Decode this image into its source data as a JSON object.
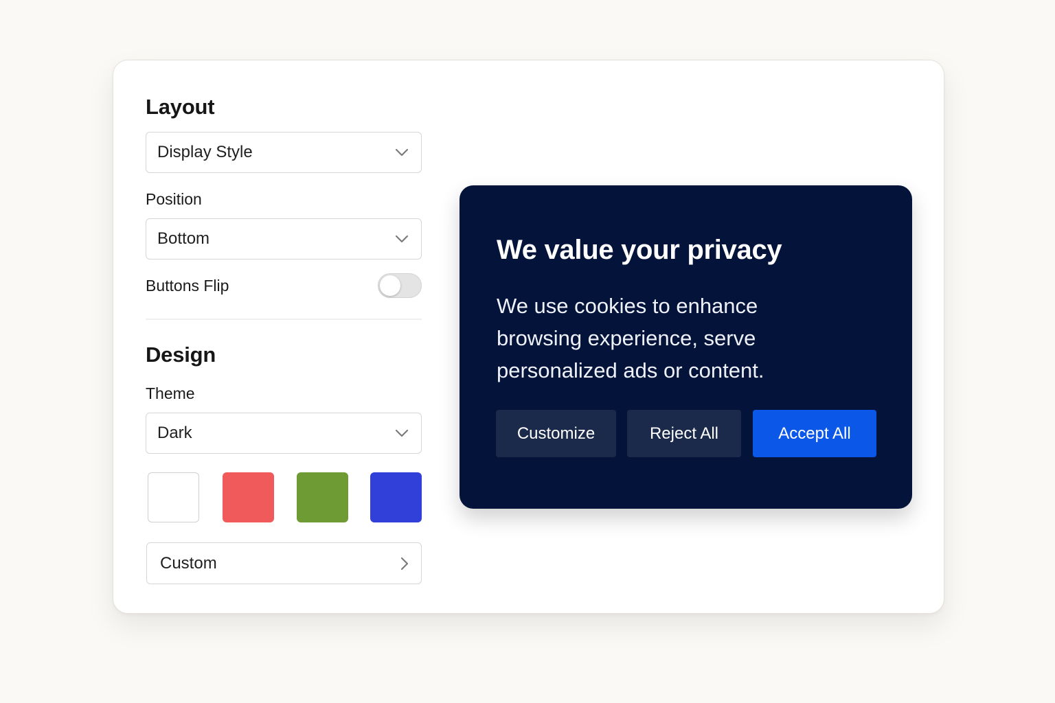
{
  "layout_section": {
    "title": "Layout",
    "display_style": {
      "value": "Display Style",
      "icon": "chevron-down-icon"
    },
    "position": {
      "label": "Position",
      "value": "Bottom",
      "icon": "chevron-down-icon"
    },
    "buttons_flip": {
      "label": "Buttons Flip",
      "enabled": false
    }
  },
  "design_section": {
    "title": "Design",
    "theme": {
      "label": "Theme",
      "value": "Dark",
      "icon": "chevron-down-icon"
    },
    "swatches": [
      {
        "name": "white",
        "color": "#ffffff"
      },
      {
        "name": "red",
        "color": "#f05a5a"
      },
      {
        "name": "green",
        "color": "#6f9b35"
      },
      {
        "name": "blue",
        "color": "#3140d8"
      }
    ],
    "custom": {
      "label": "Custom",
      "icon": "chevron-right-icon"
    }
  },
  "banner": {
    "title": "We value your privacy",
    "text": "We use cookies to enhance browsing experience, serve personalized ads or content.",
    "background": "#04133a",
    "buttons": {
      "customize": "Customize",
      "reject": "Reject All",
      "accept": "Accept All"
    },
    "accent": "#0b57e8"
  }
}
